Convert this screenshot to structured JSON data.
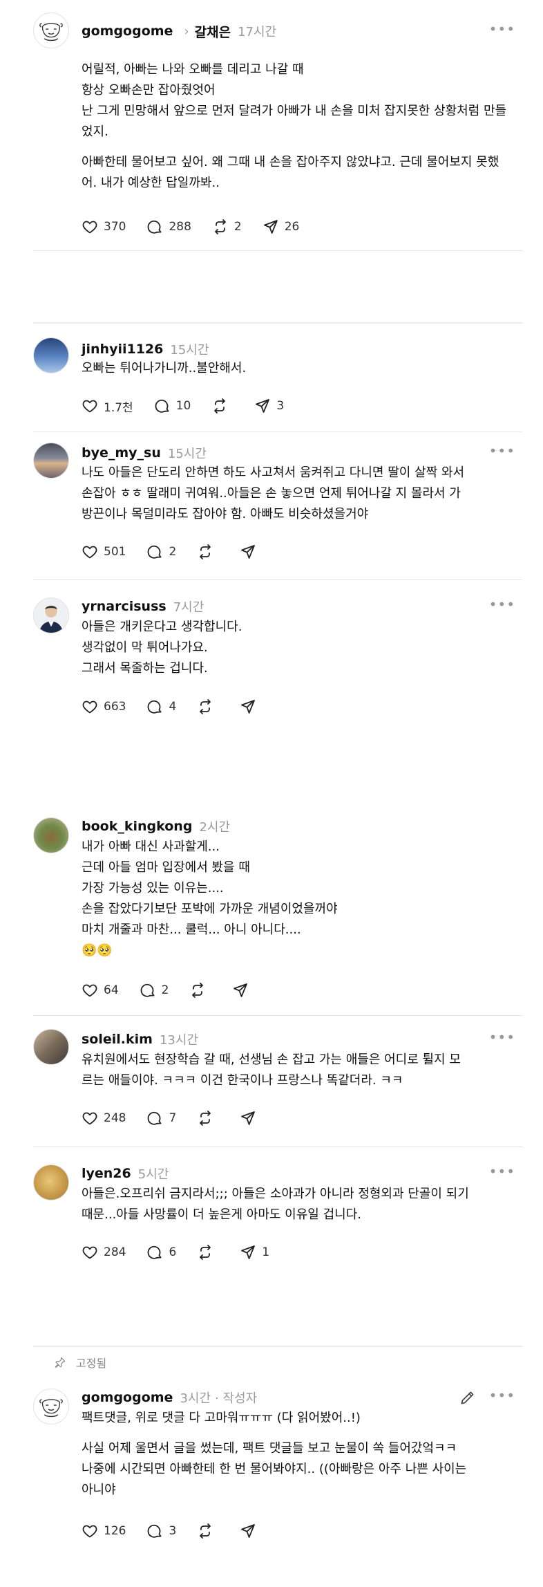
{
  "colors": {
    "text": "#111111",
    "muted": "#9a9a9a",
    "divider": "#e5e5e5"
  },
  "original_post": {
    "username": "gomgogome",
    "reply_to": "갈채은",
    "time": "17시간",
    "lines": [
      "어릴적, 아빠는 나와 오빠를 데리고 나갈 때",
      "항상 오빠손만 잡아줬엇어",
      "난 그게 민망해서 앞으로 먼저 달려가 아빠가 내 손을 미처 잡지못한 상황처럼 만들",
      "었지.",
      "아빠한테 물어보고 싶어. 왜 그때 내 손을 잡아주지 않았냐고. 근데 물어보지 못했",
      "어. 내가 예상한 답일까봐.."
    ],
    "likes": "370",
    "comments": "288",
    "reposts": "2",
    "shares": "26"
  },
  "replies": [
    {
      "username": "jinhyii1126",
      "time": "15시간",
      "lines": [
        "오빠는 튀어나가니까..불안해서."
      ],
      "likes": "1.7천",
      "comments": "10",
      "reposts": "",
      "shares": "3"
    },
    {
      "username": "bye_my_su",
      "time": "15시간",
      "lines": [
        "나도 아들은 단도리 안하면 하도 사고쳐서 움켜쥐고 다니면 딸이 살짝 와서",
        "손잡아 ㅎㅎ 딸래미 귀여워..아들은 손 놓으면 언제 튀어나갈 지 몰라서 가",
        "방끈이나 목덜미라도 잡아야 함. 아빠도 비슷하셨을거야"
      ],
      "likes": "501",
      "comments": "2",
      "reposts": "",
      "shares": ""
    },
    {
      "username": "yrnarcisuss",
      "time": "7시간",
      "lines": [
        "아들은 개키운다고 생각합니다.",
        "생각없이 막 튀어나가요.",
        "그래서 목줄하는 겁니다."
      ],
      "likes": "663",
      "comments": "4",
      "reposts": "",
      "shares": ""
    },
    {
      "username": "book_kingkong",
      "time": "2시간",
      "lines": [
        "내가 아빠 대신 사과할게...",
        "근데 아들 엄마 입장에서 봤을 때",
        "가장 가능성 있는 이유는....",
        "손을 잡았다기보단 포박에 가까운 개념이었을꺼야",
        "마치 개줄과 마찬... 쿨럭... 아니 아니다....",
        "🥺🥺"
      ],
      "likes": "64",
      "comments": "2",
      "reposts": "",
      "shares": ""
    },
    {
      "username": "soleil.kim",
      "time": "13시간",
      "lines": [
        "유치원에서도 현장학습 갈 때, 선생님 손 잡고 가는 애들은 어디로 튈지 모",
        "르는 애들이야. ㅋㅋㅋ 이건 한국이나 프랑스나 똑같더라. ㅋㅋ"
      ],
      "likes": "248",
      "comments": "7",
      "reposts": "",
      "shares": ""
    },
    {
      "username": "lyen26",
      "time": "5시간",
      "lines": [
        "아들은.오프리쉬 금지라서;;; 아들은 소아과가 아니라 정형외과 단골이 되기",
        "때문...아들 사망률이 더 높은게 아마도 이유일 겁니다."
      ],
      "likes": "284",
      "comments": "6",
      "reposts": "",
      "shares": "1"
    }
  ],
  "pinned_label": "고정됨",
  "author_reply": {
    "username": "gomgogome",
    "time": "3시간",
    "author_label": "· 작성자",
    "lines": [
      "팩트댓글, 위로 댓글 다 고마워ㅠㅠㅠ (다 읽어봤어..!)"
    ],
    "lines2": [
      "사실 어제 울면서 글을 썼는데, 팩트 댓글들 보고 눈물이 쏙 들어갔엌ㅋㅋ",
      "나중에 시간되면 아빠한테 한 번 물어봐야지.. ((아빠랑은 아주 나쁜 사이는",
      "아니야"
    ],
    "likes": "126",
    "comments": "3",
    "reposts": "",
    "shares": ""
  },
  "icons": [
    "heart-icon",
    "comment-icon",
    "repost-icon",
    "share-icon",
    "more-icon",
    "pin-icon",
    "edit-icon",
    "chevron-right-icon"
  ]
}
